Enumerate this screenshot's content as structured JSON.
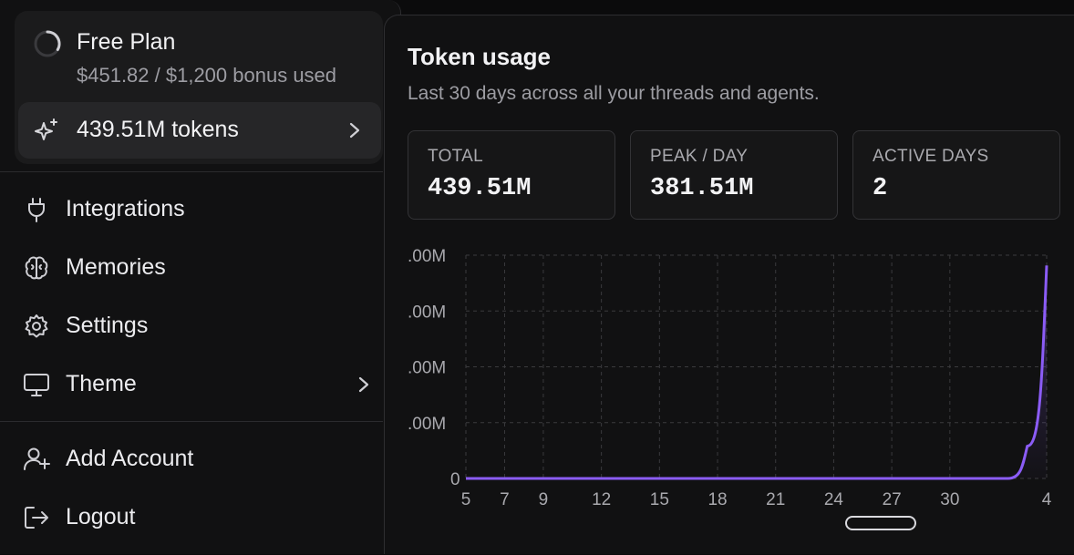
{
  "plan": {
    "name": "Free Plan",
    "usage": "$451.82 / $1,200 bonus used",
    "tokens_label": "439.51M tokens"
  },
  "menu": {
    "items": [
      {
        "label": "Integrations",
        "icon": "plug-icon"
      },
      {
        "label": "Memories",
        "icon": "brain-icon"
      },
      {
        "label": "Settings",
        "icon": "gear-icon"
      },
      {
        "label": "Theme",
        "icon": "monitor-icon"
      },
      {
        "label": "Add Account",
        "icon": "user-plus-icon"
      },
      {
        "label": "Logout",
        "icon": "logout-icon"
      }
    ]
  },
  "usage_panel": {
    "title": "Token usage",
    "subtitle": "Last 30 days across all your threads and agents.",
    "stats": [
      {
        "label": "TOTAL",
        "value": "439.51M"
      },
      {
        "label": "PEAK / DAY",
        "value": "381.51M"
      },
      {
        "label": "ACTIVE DAYS",
        "value": "2"
      }
    ]
  },
  "colors": {
    "accent": "#8b5cf6",
    "background": "#0b0b0c",
    "panel": "#111112"
  },
  "chart_data": {
    "type": "area",
    "title": "",
    "xlabel": "",
    "ylabel": "",
    "x_tick_labels": [
      "5",
      "7",
      "9",
      "12",
      "15",
      "18",
      "21",
      "24",
      "27",
      "30",
      "4"
    ],
    "y_tick_labels": [
      ".00M",
      ".00M",
      ".00M",
      ".00M",
      "0"
    ],
    "x": [
      "5",
      "6",
      "7",
      "8",
      "9",
      "10",
      "11",
      "12",
      "13",
      "14",
      "15",
      "16",
      "17",
      "18",
      "19",
      "20",
      "21",
      "22",
      "23",
      "24",
      "25",
      "26",
      "27",
      "28",
      "29",
      "30",
      "31",
      "1",
      "2",
      "3",
      "4"
    ],
    "series": [
      {
        "values": [
          0,
          0,
          0,
          0,
          0,
          0,
          0,
          0,
          0,
          0,
          0,
          0,
          0,
          0,
          0,
          0,
          0,
          0,
          0,
          0,
          0,
          0,
          0,
          0,
          0,
          0,
          0,
          0,
          0,
          58,
          381.51
        ]
      }
    ],
    "ylim": [
      0,
      400
    ],
    "grid": true,
    "legend": "none"
  }
}
